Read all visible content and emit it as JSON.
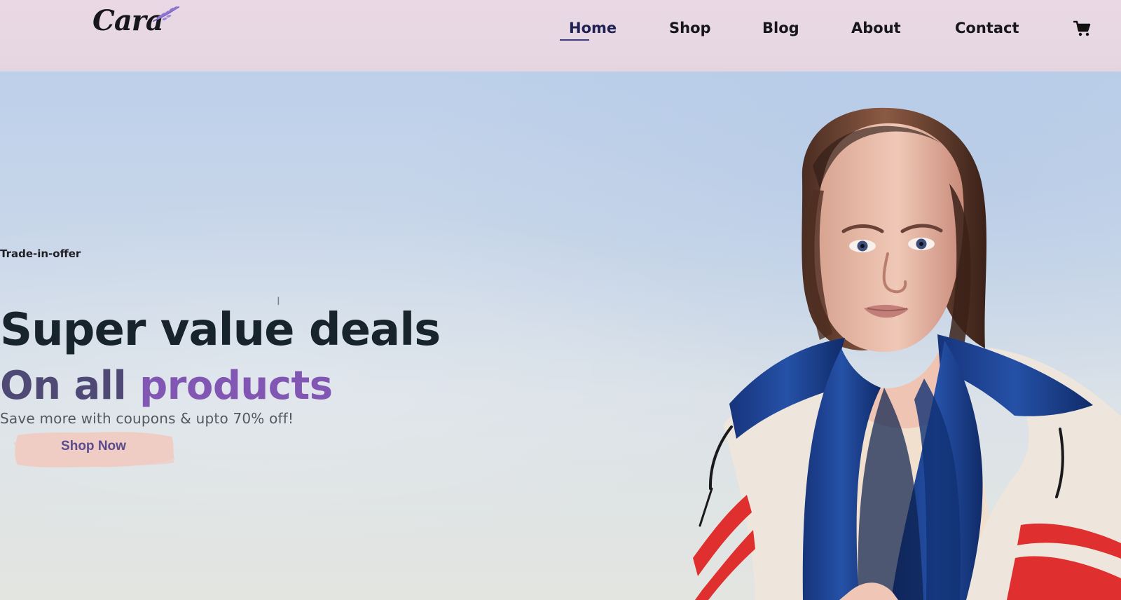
{
  "brand": {
    "logo_text": "Cara",
    "logo_icon": "lavender-leaf-icon",
    "accent": "#8257b4"
  },
  "nav": {
    "items": [
      {
        "label": "Home",
        "active": true
      },
      {
        "label": "Shop",
        "active": false
      },
      {
        "label": "Blog",
        "active": false
      },
      {
        "label": "About",
        "active": false
      },
      {
        "label": "Contact",
        "active": false
      }
    ],
    "cart_icon": "cart-icon"
  },
  "hero": {
    "eyebrow": "Trade-in-offer",
    "headline_line_1": "Super value deals",
    "headline_line_2_part_1": "On all ",
    "headline_line_2_part_2": "products",
    "subtext": "Save more with coupons & upto 70% off!",
    "cta_label": "Shop Now",
    "text_cursor": "I",
    "image_subject": "model-jacket-image",
    "colors": {
      "background_top": "#bdd0ea",
      "background_bottom": "#e3e5e0",
      "headline": "#18242c",
      "headline_muted": "#4e4a75",
      "cta_bg": "#efcdc4",
      "cta_text": "#5a4c8f",
      "jacket_blue": "#1f3f91",
      "jacket_red": "#df2f2e",
      "jacket_cream": "#eee6dc"
    }
  }
}
